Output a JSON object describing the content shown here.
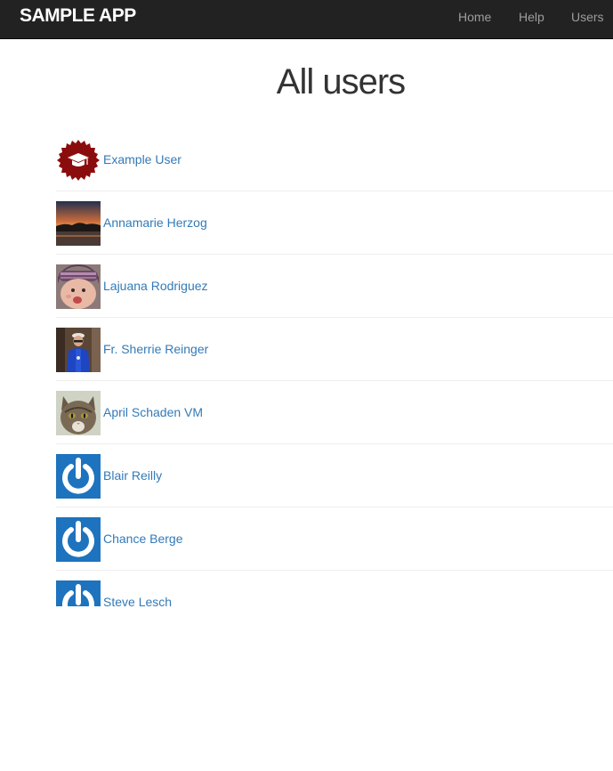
{
  "app": {
    "brand": "SAMPLE APP"
  },
  "nav": {
    "home": "Home",
    "help": "Help",
    "users": "Users"
  },
  "page": {
    "title": "All users"
  },
  "users": [
    {
      "name": "Example User",
      "avatar": "graduation-cap-seal-icon"
    },
    {
      "name": "Annamarie Herzog",
      "avatar": "sunset-photo"
    },
    {
      "name": "Lajuana Rodriguez",
      "avatar": "child-photo"
    },
    {
      "name": "Fr. Sherrie Reinger",
      "avatar": "person-photo"
    },
    {
      "name": "April Schaden VM",
      "avatar": "cat-photo"
    },
    {
      "name": "Blair Reilly",
      "avatar": "gravatar-default-icon"
    },
    {
      "name": "Chance Berge",
      "avatar": "gravatar-default-icon"
    },
    {
      "name": "Steve Lesch",
      "avatar": "gravatar-default-icon"
    }
  ],
  "colors": {
    "navbar": "#222222",
    "link": "#337ab7",
    "gravatar": "#1e73be",
    "seal": "#8b0c0c"
  }
}
